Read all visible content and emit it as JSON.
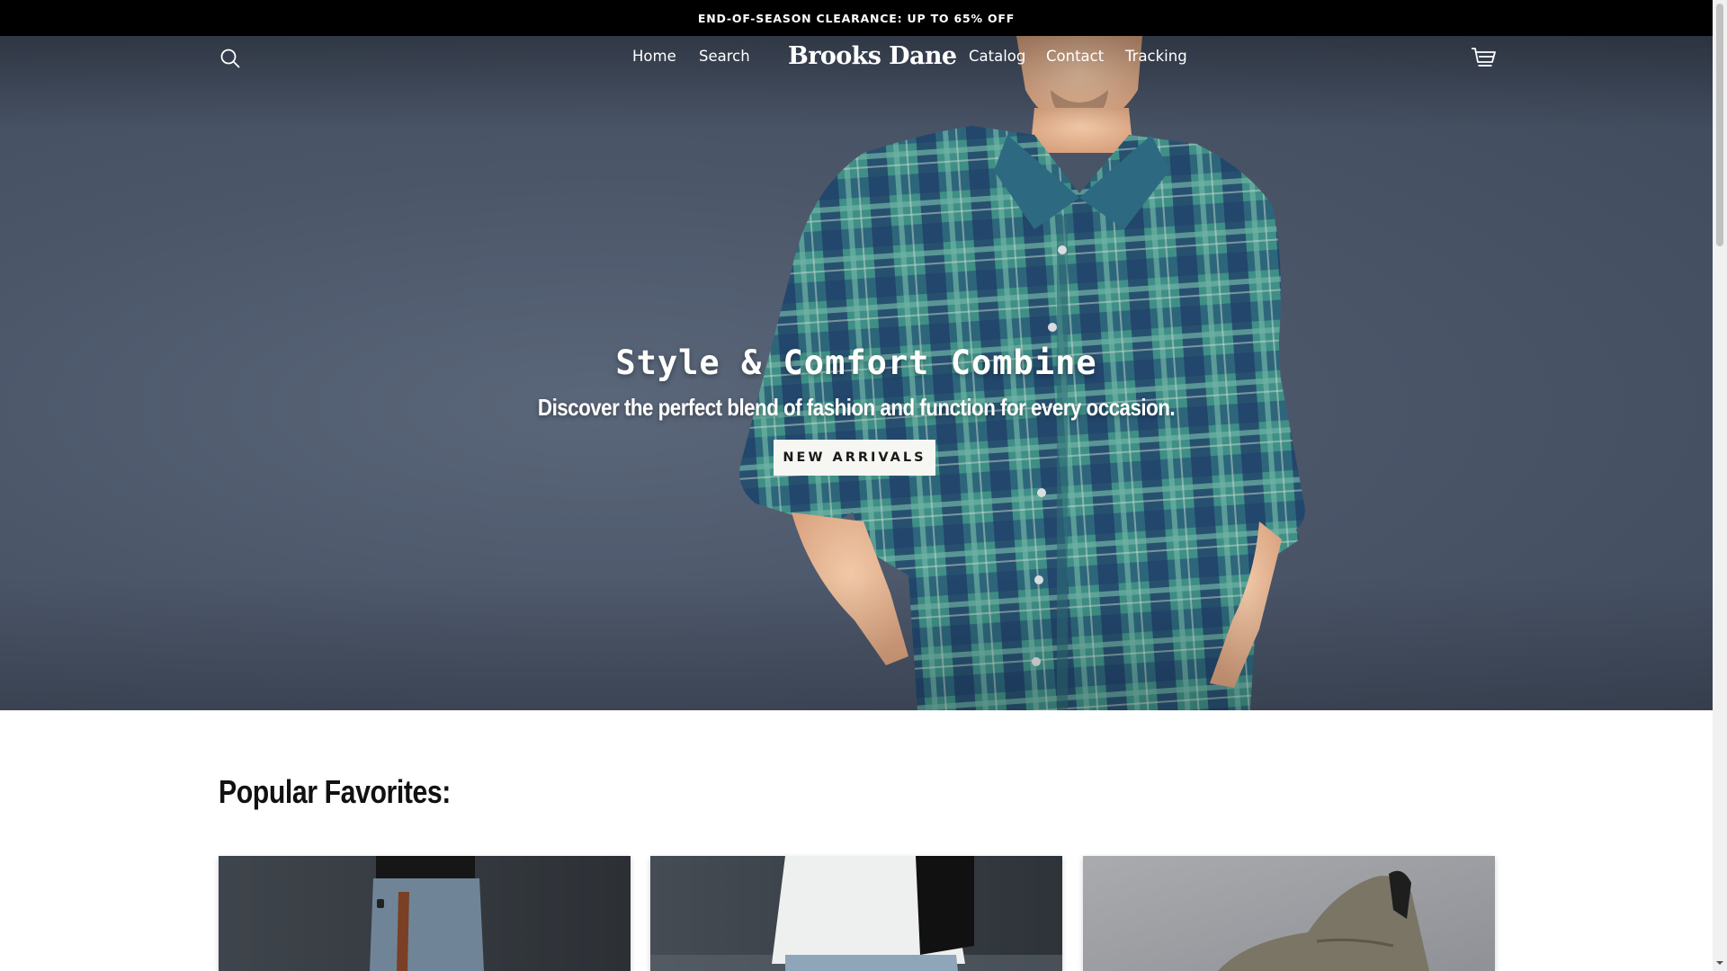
{
  "announcement": {
    "text": "END-OF-SEASON CLEARANCE: UP TO 65% OFF"
  },
  "header": {
    "logo": "Brooks Dane",
    "nav": [
      {
        "label": "Home"
      },
      {
        "label": "Search"
      },
      {
        "label": "Catalog"
      },
      {
        "label": "Contact"
      },
      {
        "label": "Tracking"
      }
    ],
    "icons": {
      "search": "search-icon",
      "cart": "cart-icon"
    }
  },
  "hero": {
    "title": "Style & Comfort Combine",
    "subtitle": "Discover the perfect blend of fashion and function for every occasion.",
    "cta_label": "NEW ARRIVALS"
  },
  "section": {
    "title": "Popular Favorites:"
  },
  "products": [
    {
      "image": "man-in-black-top-and-denim-jeans"
    },
    {
      "image": "man-in-white-shirt-with-black-backpack"
    },
    {
      "image": "olive-suede-sneaker"
    }
  ],
  "colors": {
    "announcement_bg": "#000000",
    "hero_bg": "#4b5669",
    "shirt_green": "#3f8f86",
    "shirt_navy": "#1f3b66",
    "button_bg": "#f6f6f3"
  }
}
